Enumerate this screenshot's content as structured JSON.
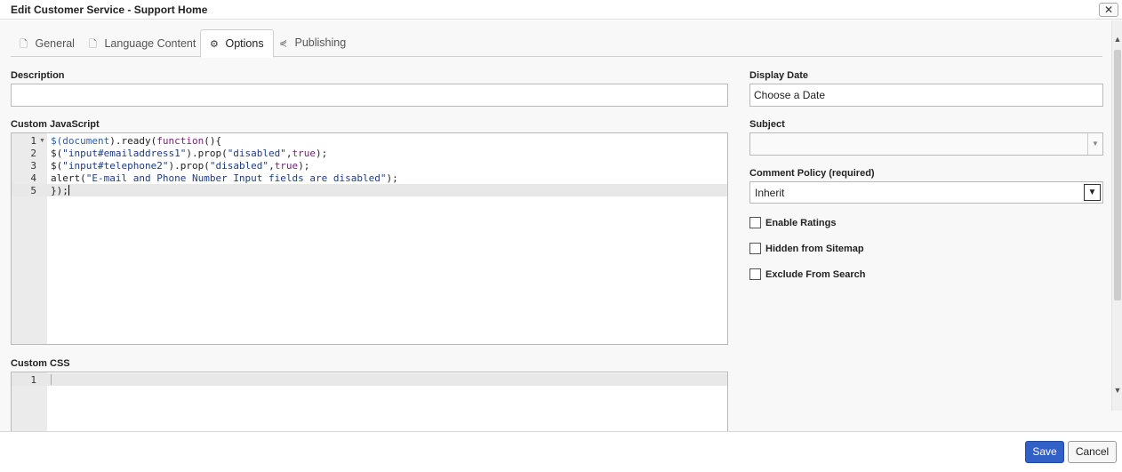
{
  "dialog": {
    "title": "Edit Customer Service - Support Home",
    "close_glyph": "✕"
  },
  "tabs": [
    {
      "label": "General",
      "icon": "document-icon",
      "glyph": "🗋"
    },
    {
      "label": "Language Content",
      "icon": "document-icon",
      "glyph": "🗋"
    },
    {
      "label": "Options",
      "icon": "gear-icon",
      "glyph": "⚙"
    },
    {
      "label": "Publishing",
      "icon": "share-icon",
      "glyph": "⋞"
    }
  ],
  "left": {
    "description_label": "Description",
    "description_value": "",
    "custom_js_label": "Custom JavaScript",
    "custom_js_lines": [
      {
        "num": "1",
        "text": "$(document).ready(function(){"
      },
      {
        "num": "2",
        "text": "$(\"input#emailaddress1\").prop(\"disabled\",true);"
      },
      {
        "num": "3",
        "text": "$(\"input#telephone2\").prop(\"disabled\",true);"
      },
      {
        "num": "4",
        "text": "alert(\"E-mail and Phone Number Input fields are disabled\");"
      },
      {
        "num": "5",
        "text": "});"
      }
    ],
    "custom_css_label": "Custom CSS",
    "custom_css_lines": [
      {
        "num": "1",
        "text": ""
      }
    ]
  },
  "right": {
    "display_date_label": "Display Date",
    "display_date_value": "Choose a Date",
    "subject_label": "Subject",
    "subject_value": "",
    "comment_policy_label": "Comment Policy (required)",
    "comment_policy_value": "Inherit",
    "checkboxes": [
      {
        "label": "Enable Ratings",
        "checked": false
      },
      {
        "label": "Hidden from Sitemap",
        "checked": false
      },
      {
        "label": "Exclude From Search",
        "checked": false
      }
    ]
  },
  "footer": {
    "save_label": "Save",
    "cancel_label": "Cancel"
  },
  "colors": {
    "primary_button": "#3161c7",
    "panel_bg": "#f8f8f8"
  }
}
